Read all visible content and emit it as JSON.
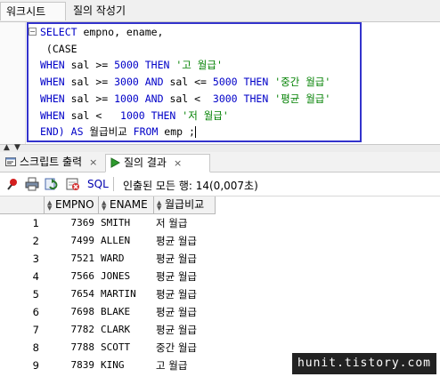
{
  "top_tabs": [
    "워크시트",
    "질의 작성기"
  ],
  "sql_lines": [
    [
      [
        "kw",
        "SELECT"
      ],
      [
        "t",
        " empno, ename,"
      ]
    ],
    [
      [
        "t",
        " (CASE"
      ]
    ],
    [
      [
        "kw",
        "WHEN"
      ],
      [
        "t",
        " sal >= "
      ],
      [
        "num",
        "5000"
      ],
      [
        "t",
        " "
      ],
      [
        "kw",
        "THEN"
      ],
      [
        "t",
        " "
      ],
      [
        "str",
        "'고 월급'"
      ]
    ],
    [
      [
        "kw",
        "WHEN"
      ],
      [
        "t",
        " sal >= "
      ],
      [
        "num",
        "3000"
      ],
      [
        "t",
        " "
      ],
      [
        "kw",
        "AND"
      ],
      [
        "t",
        " sal <= "
      ],
      [
        "num",
        "5000"
      ],
      [
        "t",
        " "
      ],
      [
        "kw",
        "THEN"
      ],
      [
        "t",
        " "
      ],
      [
        "str",
        "'중간 월급'"
      ]
    ],
    [
      [
        "kw",
        "WHEN"
      ],
      [
        "t",
        " sal >= "
      ],
      [
        "num",
        "1000"
      ],
      [
        "t",
        " "
      ],
      [
        "kw",
        "AND"
      ],
      [
        "t",
        " sal <  "
      ],
      [
        "num",
        "3000"
      ],
      [
        "t",
        " "
      ],
      [
        "kw",
        "THEN"
      ],
      [
        "t",
        " "
      ],
      [
        "str",
        "'평균 월급'"
      ]
    ],
    [
      [
        "kw",
        "WHEN"
      ],
      [
        "t",
        " sal <   "
      ],
      [
        "num",
        "1000"
      ],
      [
        "t",
        " "
      ],
      [
        "kw",
        "THEN"
      ],
      [
        "t",
        " "
      ],
      [
        "str",
        "'저 월급'"
      ]
    ],
    [
      [
        "kw",
        "END)"
      ],
      [
        "t",
        " "
      ],
      [
        "kw",
        "AS"
      ],
      [
        "t",
        " 월급비교 "
      ],
      [
        "kw",
        "FROM"
      ],
      [
        "t",
        " emp ;"
      ]
    ]
  ],
  "fold_marker": "−",
  "result_tabs": [
    {
      "label": "스크립트 출력",
      "close": "×",
      "active": false,
      "icon": "script-output-icon"
    },
    {
      "label": "질의 결과",
      "close": "×",
      "active": true,
      "icon": "run-query-icon"
    }
  ],
  "toolbar": {
    "sql_label": "SQL",
    "status": "인출된 모든 행: 14(0,007초)",
    "icons": [
      "pin-icon",
      "print-icon",
      "refresh-icon",
      "export-icon"
    ]
  },
  "columns": [
    "EMPNO",
    "ENAME",
    "월급비교"
  ],
  "rows": [
    {
      "n": "1",
      "empno": "7369",
      "ename": "SMITH",
      "grade": "저 월급"
    },
    {
      "n": "2",
      "empno": "7499",
      "ename": "ALLEN",
      "grade": "평균 월급"
    },
    {
      "n": "3",
      "empno": "7521",
      "ename": "WARD",
      "grade": "평균 월급"
    },
    {
      "n": "4",
      "empno": "7566",
      "ename": "JONES",
      "grade": "평균 월급"
    },
    {
      "n": "5",
      "empno": "7654",
      "ename": "MARTIN",
      "grade": "평균 월급"
    },
    {
      "n": "6",
      "empno": "7698",
      "ename": "BLAKE",
      "grade": "평균 월급"
    },
    {
      "n": "7",
      "empno": "7782",
      "ename": "CLARK",
      "grade": "평균 월급"
    },
    {
      "n": "8",
      "empno": "7788",
      "ename": "SCOTT",
      "grade": "중간 월급"
    },
    {
      "n": "9",
      "empno": "7839",
      "ename": "KING",
      "grade": "고 월급"
    }
  ],
  "watermark": "hunit.tistory.com",
  "colors": {
    "highlight_border": "#3333cc",
    "keyword": "#0000c8",
    "string": "#008000"
  }
}
